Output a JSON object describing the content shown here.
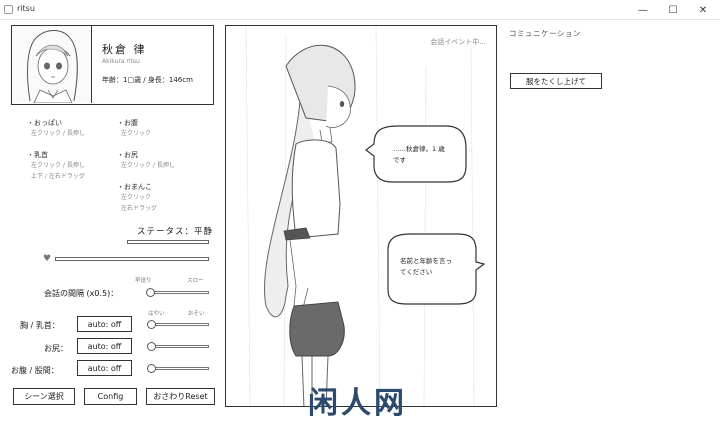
{
  "window": {
    "title": "ritsu",
    "minimize": "—",
    "maximize": "☐",
    "close": "✕"
  },
  "profile": {
    "name": "秋倉 律",
    "romaji": "Akikura ritsu",
    "info": "年齢：1□歳 / 身長：146cm"
  },
  "touch_areas": [
    {
      "label": "・おっぱい",
      "hint1": "左クリック / 長押し",
      "hint2": ""
    },
    {
      "label": "・乳首",
      "hint1": "左クリック / 長押し",
      "hint2": "上下 / 左右ドラッグ"
    },
    {
      "label": "・お腹",
      "hint1": "左クリック",
      "hint2": ""
    },
    {
      "label": "・お尻",
      "hint1": "左クリック / 長押し",
      "hint2": ""
    },
    {
      "label": "・おまんこ",
      "hint1": "左クリック",
      "hint2": "左右ドラッグ"
    }
  ],
  "status": {
    "label": "ステータス：平静",
    "status_level": 0,
    "heart_level": 0
  },
  "interval": {
    "label": "会話の間隔 (x0.5)：",
    "fast": "早送り",
    "slow": "スロー",
    "value_fraction": 0.04
  },
  "speed_labels": {
    "fast": "はやい",
    "slow": "おそい"
  },
  "controls": [
    {
      "label": "胸 / 乳首：",
      "value": "auto: off",
      "slider_fraction": 0.05
    },
    {
      "label": "お尻：",
      "value": "auto: off",
      "slider_fraction": 0.05
    },
    {
      "label": "お腹 / 股間：",
      "value": "auto: off",
      "slider_fraction": 0.05
    }
  ],
  "buttons": {
    "scene": "シーン選択",
    "config": "Config",
    "reset": "おさわりReset"
  },
  "stage": {
    "status": "会話イベント中...",
    "bubble1": "……秋倉律。1 歳\nです",
    "bubble2": "名前と年齢を言っ\nてください"
  },
  "communication": {
    "label": "コミュニケーション",
    "command": "服をたくし上げて"
  },
  "watermark": "闲人网"
}
